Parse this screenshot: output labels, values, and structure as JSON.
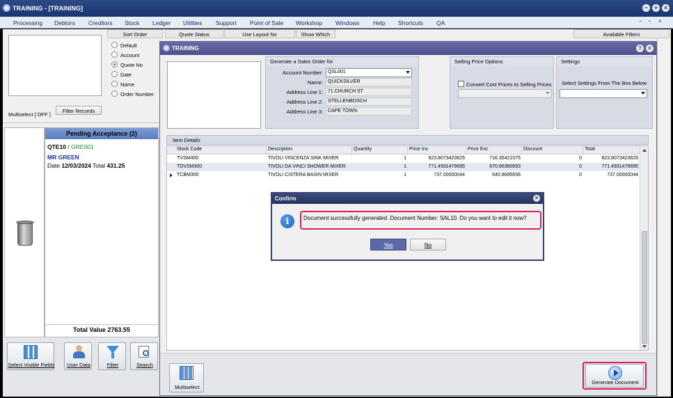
{
  "app": {
    "title": "TRAINING - [TRAINING]"
  },
  "menu": [
    "Processing",
    "Debtors",
    "Creditors",
    "Stock",
    "Ledger",
    "Utilities",
    "Support",
    "Point of Sale",
    "Workshop",
    "Windows",
    "Help",
    "Shortcuts",
    "QA"
  ],
  "tabs": {
    "sort_order": "Sort Order",
    "quote_status": "Quote Status",
    "use_layout_no": "Use Layout No",
    "show_which": "Show Which",
    "available_filters": "Available Filters"
  },
  "sort_options": [
    {
      "label": "Default",
      "selected": false
    },
    {
      "label": "Account",
      "selected": false
    },
    {
      "label": "Quote No",
      "selected": true
    },
    {
      "label": "Date",
      "selected": false
    },
    {
      "label": "Name",
      "selected": false
    },
    {
      "label": "Order Number",
      "selected": false
    }
  ],
  "multiselect_label": "Multiselect [ OFF ]",
  "filter_records_label": "Filter Records",
  "pending": {
    "header": "Pending Acceptance (2)",
    "quote_no": "QTE10",
    "separator": " / ",
    "account": "GRE001",
    "name": "MR GREEN",
    "date_label": "Date",
    "date": "12/03/2024",
    "total_label": "Total",
    "total": "431.25",
    "total_value": "Total Value 2763.55"
  },
  "left_toolbar": [
    {
      "label": "Select Visible Fields",
      "icon": "columns-icon"
    },
    {
      "label": "User Data",
      "icon": "user-data-icon"
    },
    {
      "label": "Filter",
      "icon": "funnel-icon"
    },
    {
      "label": "Search",
      "icon": "search-icon"
    }
  ],
  "window": {
    "title": "TRAINING",
    "help": "?",
    "close": "×"
  },
  "sales_order": {
    "header": "Generate a Sales Order for",
    "account_label": "Account Number:",
    "account": "QSL001",
    "name_label": "Name:",
    "name": "QUICKSILVER",
    "addr1_label": "Address Line 1:",
    "addr1": "71 CHURCH ST",
    "addr2_label": "Address Line 2:",
    "addr2": "STELLENBOSCH",
    "addr3_label": "Address Line 3:",
    "addr3": "CAPE TOWN"
  },
  "price_options": {
    "header": "Selling Price Options",
    "checkbox_label": "Convert Cost Prices to Selling Prices",
    "checked": false
  },
  "settings": {
    "header": "Settings",
    "label": "Select Settings From The Box Below"
  },
  "item_details": {
    "header": "Item Details",
    "columns": [
      "Stock Code",
      "Description",
      "Quantity",
      "Price Inc",
      "Price Exc",
      "Discount",
      "Total"
    ],
    "rows": [
      {
        "code": "TVSM400",
        "desc": "TIVOLI VINCENZA SINK MIXER",
        "qty": "1",
        "inc": "823.8073423625",
        "exc": "716.35421075",
        "disc": "0",
        "total": "823.8073423625"
      },
      {
        "code": "TDVSM300",
        "desc": "TIVOLI DA VINCI SHOWER MIXER",
        "qty": "1",
        "inc": "771.4931479695",
        "exc": "670.86360693",
        "disc": "0",
        "total": "771.4931479695"
      },
      {
        "code": "TCBM300",
        "desc": "TIVOLI CISTERA BASIN MIXER",
        "qty": "1",
        "inc": "737.00000044",
        "exc": "640.8695656",
        "disc": "0",
        "total": "737.00000044"
      }
    ]
  },
  "confirm": {
    "title": "Confirm",
    "message": "Document successfully generated. Document Number: SAL10. Do you want to edit it now?",
    "yes": "Yes",
    "no": "No"
  },
  "bottom": {
    "multiselect": "Multiselect",
    "generate": "Generate Document"
  },
  "colors": {
    "highlight": "#d6245a",
    "titlebar": "#233d78",
    "selected_yes": "#5a6aa8"
  }
}
